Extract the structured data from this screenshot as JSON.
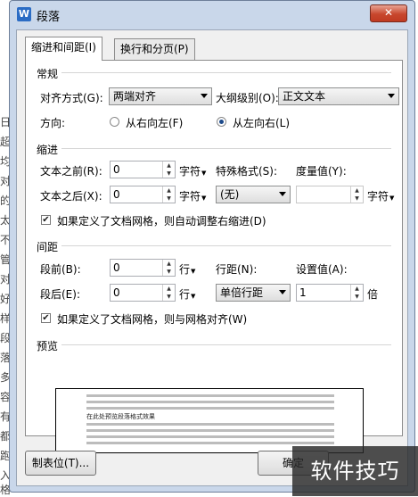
{
  "window": {
    "title": "段落",
    "close_glyph": "✕",
    "app_icon_letter": "W"
  },
  "background": {
    "left_chars": [
      "日",
      "超",
      "均",
      "对",
      "的",
      "太",
      "不",
      "管",
      "对",
      "好",
      "样",
      "段",
      "落",
      "多",
      "容",
      "有",
      "都",
      "跑",
      "入",
      "格"
    ]
  },
  "tabs": [
    {
      "label": "缩进和间距(I)",
      "active": true
    },
    {
      "label": "换行和分页(P)",
      "active": false
    }
  ],
  "general": {
    "section": "常规",
    "alignment_label": "对齐方式(G):",
    "alignment_value": "两端对齐",
    "outline_label": "大纲级别(O):",
    "outline_value": "正文文本",
    "direction_label": "方向:",
    "rtl_label": "从右向左(F)",
    "ltr_label": "从左向右(L)"
  },
  "indent": {
    "section": "缩进",
    "before_label": "文本之前(R):",
    "before_value": "0",
    "after_label": "文本之后(X):",
    "after_value": "0",
    "unit": "字符",
    "special_label": "特殊格式(S):",
    "special_value": "(无)",
    "measure_label": "度量值(Y):",
    "measure_value": "",
    "measure_unit": "字符",
    "auto_adjust_label": "如果定义了文档网格，则自动调整右缩进(D)",
    "auto_adjust_checked": true
  },
  "spacing": {
    "section": "间距",
    "before_label": "段前(B):",
    "before_value": "0",
    "after_label": "段后(E):",
    "after_value": "0",
    "unit": "行",
    "line_label": "行距(N):",
    "line_value": "单倍行距",
    "set_label": "设置值(A):",
    "set_value": "1",
    "set_unit": "倍",
    "snap_label": "如果定义了文档网格，则与网格对齐(W)",
    "snap_checked": true
  },
  "preview": {
    "section": "预览",
    "sample_text": "在此处预览段落格式效果"
  },
  "buttons": {
    "tabs_label": "制表位(T)...",
    "ok_label": "确定"
  },
  "watermark": {
    "text": "软件技巧"
  }
}
